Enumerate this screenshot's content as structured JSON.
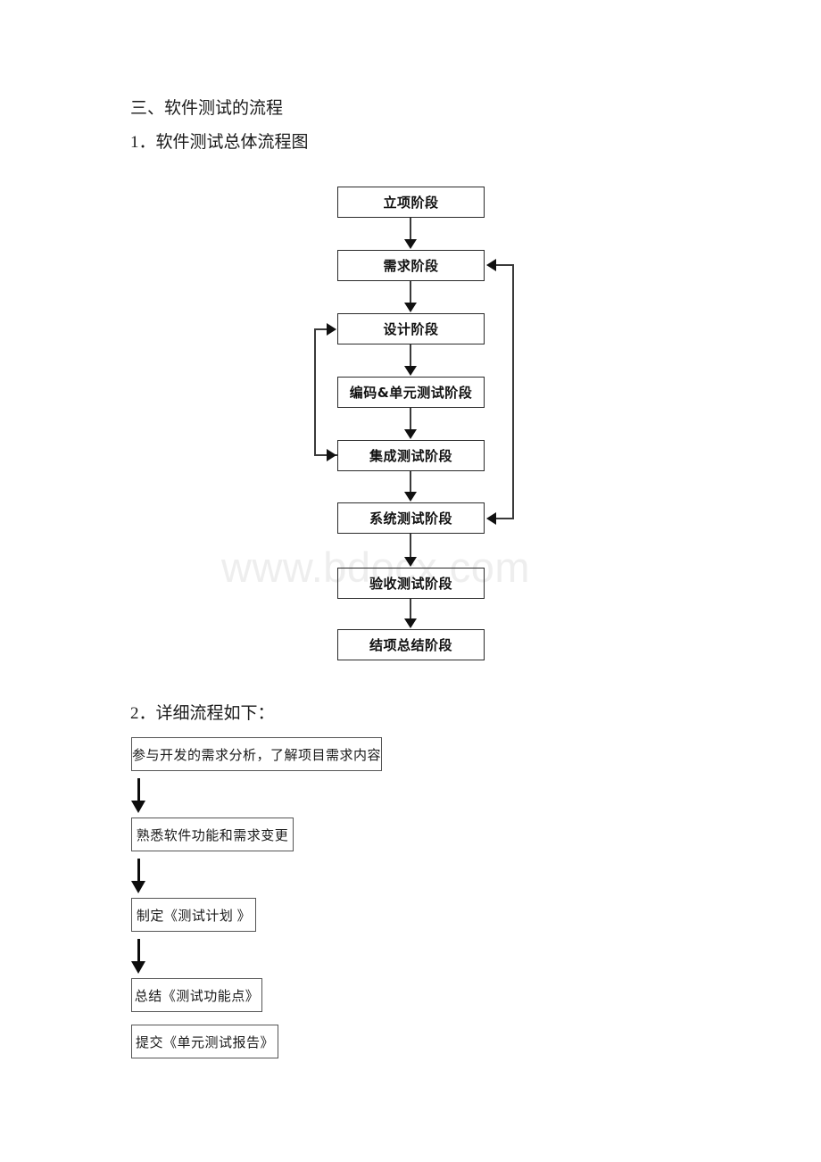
{
  "document": {
    "watermark": "www.bdocx.com",
    "headings": {
      "section3": "三、软件测试的流程",
      "item1": "1．软件测试总体流程图",
      "item2": "2．详细流程如下："
    }
  },
  "overall_flow": {
    "name": "软件测试总体流程图",
    "boxes": [
      {
        "id": "b0",
        "label": "立项阶段"
      },
      {
        "id": "b1",
        "label": "需求阶段"
      },
      {
        "id": "b2",
        "label": "设计阶段"
      },
      {
        "id": "b3",
        "label": "编码&单元测试阶段"
      },
      {
        "id": "b4",
        "label": "集成测试阶段"
      },
      {
        "id": "b5",
        "label": "系统测试阶段"
      },
      {
        "id": "b6",
        "label": "验收测试阶段"
      },
      {
        "id": "b7",
        "label": "结项总结阶段"
      }
    ],
    "edges": [
      {
        "from": "立项阶段",
        "to": "需求阶段",
        "kind": "down"
      },
      {
        "from": "需求阶段",
        "to": "设计阶段",
        "kind": "down"
      },
      {
        "from": "设计阶段",
        "to": "编码&单元测试阶段",
        "kind": "down"
      },
      {
        "from": "编码&单元测试阶段",
        "to": "集成测试阶段",
        "kind": "down"
      },
      {
        "from": "集成测试阶段",
        "to": "系统测试阶段",
        "kind": "down"
      },
      {
        "from": "系统测试阶段",
        "to": "验收测试阶段",
        "kind": "down"
      },
      {
        "from": "验收测试阶段",
        "to": "结项总结阶段",
        "kind": "down"
      },
      {
        "from": "集成测试阶段",
        "to": "设计阶段",
        "kind": "feedback-left"
      },
      {
        "from": "系统测试阶段",
        "to": "需求阶段",
        "kind": "feedback-right"
      }
    ]
  },
  "detail_flow": {
    "name": "详细流程",
    "boxes": [
      {
        "id": "d0",
        "label": "参与开发的需求分析，了解项目需求内容"
      },
      {
        "id": "d1",
        "label": "熟悉软件功能和需求变更"
      },
      {
        "id": "d2",
        "label": "制定《测试计划 》"
      },
      {
        "id": "d3",
        "label": "总结《测试功能点》"
      },
      {
        "id": "d4",
        "label": "提交《单元测试报告》"
      }
    ],
    "arrows": [
      {
        "from": "参与开发的需求分析，了解项目需求内容",
        "to": "熟悉软件功能和需求变更"
      },
      {
        "from": "熟悉软件功能和需求变更",
        "to": "制定《测试计划 》"
      },
      {
        "from": "制定《测试计划 》",
        "to": "总结《测试功能点》"
      }
    ]
  }
}
